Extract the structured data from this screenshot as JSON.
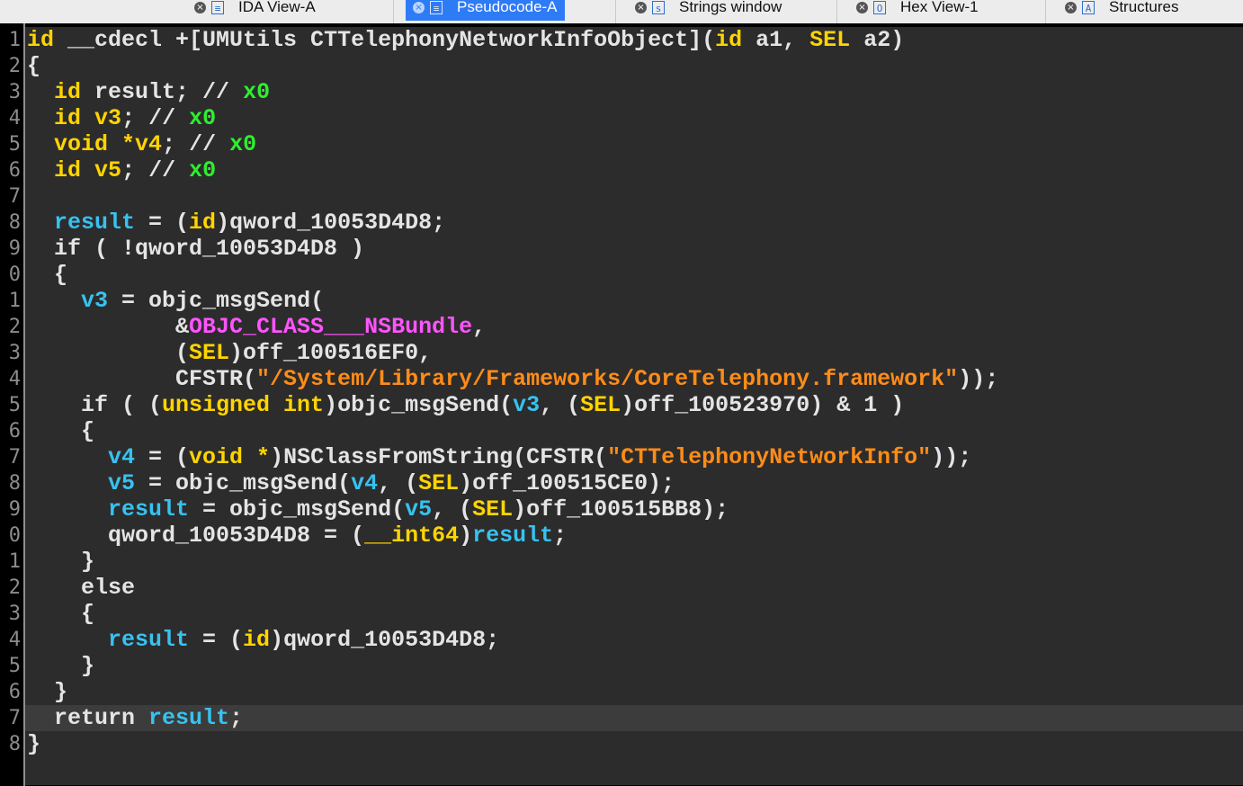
{
  "tabs": [
    {
      "label": "IDA View-A",
      "type_glyph": "≡",
      "active": false
    },
    {
      "label": "Pseudocode-A",
      "type_glyph": "≡",
      "active": true
    },
    {
      "label": "Strings window",
      "type_glyph": "s",
      "active": false
    },
    {
      "label": "Hex View-1",
      "type_glyph": "O",
      "active": false
    },
    {
      "label": "Structures",
      "type_glyph": "A",
      "active": false
    }
  ],
  "code": {
    "line_numbers": [
      "1",
      "2",
      "3",
      "4",
      "5",
      "6",
      "7",
      "8",
      "9",
      "0",
      "1",
      "2",
      "3",
      "4",
      "5",
      "6",
      "7",
      "8",
      "9",
      "0",
      "1",
      "2",
      "3",
      "4",
      "5",
      "6",
      "7",
      "8"
    ],
    "lines": [
      [
        {
          "c": "t-ty",
          "t": "id"
        },
        {
          "c": "t-f",
          "t": " __cdecl +[UMUtils CTTelephonyNetworkInfoObject]("
        },
        {
          "c": "t-ty",
          "t": "id"
        },
        {
          "c": "t-f",
          "t": " a1, "
        },
        {
          "c": "t-ty",
          "t": "SEL"
        },
        {
          "c": "t-f",
          "t": " a2)"
        }
      ],
      [
        {
          "c": "t-p",
          "t": "{"
        }
      ],
      [
        {
          "c": "t-f",
          "t": "  "
        },
        {
          "c": "t-ty",
          "t": "id"
        },
        {
          "c": "t-f",
          "t": " result; // "
        },
        {
          "c": "t-n",
          "t": "x0"
        }
      ],
      [
        {
          "c": "t-f",
          "t": "  "
        },
        {
          "c": "t-ty",
          "t": "id"
        },
        {
          "c": "t-f",
          "t": " "
        },
        {
          "c": "t-ty",
          "t": "v3"
        },
        {
          "c": "t-f",
          "t": "; // "
        },
        {
          "c": "t-n",
          "t": "x0"
        }
      ],
      [
        {
          "c": "t-f",
          "t": "  "
        },
        {
          "c": "t-ty",
          "t": "void"
        },
        {
          "c": "t-f",
          "t": " "
        },
        {
          "c": "t-ty",
          "t": "*v4"
        },
        {
          "c": "t-f",
          "t": "; // "
        },
        {
          "c": "t-n",
          "t": "x0"
        }
      ],
      [
        {
          "c": "t-f",
          "t": "  "
        },
        {
          "c": "t-ty",
          "t": "id"
        },
        {
          "c": "t-f",
          "t": " "
        },
        {
          "c": "t-ty",
          "t": "v5"
        },
        {
          "c": "t-f",
          "t": "; // "
        },
        {
          "c": "t-n",
          "t": "x0"
        }
      ],
      [
        {
          "c": "t-f",
          "t": ""
        }
      ],
      [
        {
          "c": "t-f",
          "t": "  "
        },
        {
          "c": "t-v",
          "t": "result"
        },
        {
          "c": "t-f",
          "t": " = ("
        },
        {
          "c": "t-ty",
          "t": "id"
        },
        {
          "c": "t-f",
          "t": ")qword_10053D4D8;"
        }
      ],
      [
        {
          "c": "t-f",
          "t": "  if ( !qword_10053D4D8 )"
        }
      ],
      [
        {
          "c": "t-f",
          "t": "  {"
        }
      ],
      [
        {
          "c": "t-f",
          "t": "    "
        },
        {
          "c": "t-v",
          "t": "v3"
        },
        {
          "c": "t-f",
          "t": " = objc_msgSend("
        }
      ],
      [
        {
          "c": "t-f",
          "t": "           &"
        },
        {
          "c": "t-m",
          "t": "OBJC_CLASS___NSBundle"
        },
        {
          "c": "t-f",
          "t": ","
        }
      ],
      [
        {
          "c": "t-f",
          "t": "           ("
        },
        {
          "c": "t-ty",
          "t": "SEL"
        },
        {
          "c": "t-f",
          "t": ")off_100516EF0,"
        }
      ],
      [
        {
          "c": "t-f",
          "t": "           CFSTR("
        },
        {
          "c": "t-s",
          "t": "\"/System/Library/Frameworks/CoreTelephony.framework\""
        },
        {
          "c": "t-f",
          "t": "));"
        }
      ],
      [
        {
          "c": "t-f",
          "t": "    if ( ("
        },
        {
          "c": "t-ty",
          "t": "unsigned int"
        },
        {
          "c": "t-f",
          "t": ")objc_msgSend("
        },
        {
          "c": "t-v",
          "t": "v3"
        },
        {
          "c": "t-f",
          "t": ", ("
        },
        {
          "c": "t-ty",
          "t": "SEL"
        },
        {
          "c": "t-f",
          "t": ")off_100523970) & 1 )"
        }
      ],
      [
        {
          "c": "t-f",
          "t": "    {"
        }
      ],
      [
        {
          "c": "t-f",
          "t": "      "
        },
        {
          "c": "t-v",
          "t": "v4"
        },
        {
          "c": "t-f",
          "t": " = ("
        },
        {
          "c": "t-ty",
          "t": "void *"
        },
        {
          "c": "t-f",
          "t": ")NSClassFromString(CFSTR("
        },
        {
          "c": "t-s",
          "t": "\"CTTelephonyNetworkInfo\""
        },
        {
          "c": "t-f",
          "t": "));"
        }
      ],
      [
        {
          "c": "t-f",
          "t": "      "
        },
        {
          "c": "t-v",
          "t": "v5"
        },
        {
          "c": "t-f",
          "t": " = objc_msgSend("
        },
        {
          "c": "t-v",
          "t": "v4"
        },
        {
          "c": "t-f",
          "t": ", ("
        },
        {
          "c": "t-ty",
          "t": "SEL"
        },
        {
          "c": "t-f",
          "t": ")off_100515CE0);"
        }
      ],
      [
        {
          "c": "t-f",
          "t": "      "
        },
        {
          "c": "t-v",
          "t": "result"
        },
        {
          "c": "t-f",
          "t": " = objc_msgSend("
        },
        {
          "c": "t-v",
          "t": "v5"
        },
        {
          "c": "t-f",
          "t": ", ("
        },
        {
          "c": "t-ty",
          "t": "SEL"
        },
        {
          "c": "t-f",
          "t": ")off_100515BB8);"
        }
      ],
      [
        {
          "c": "t-f",
          "t": "      qword_10053D4D8 = ("
        },
        {
          "c": "t-ty",
          "t": "__int64"
        },
        {
          "c": "t-f",
          "t": ")"
        },
        {
          "c": "t-v",
          "t": "result"
        },
        {
          "c": "t-f",
          "t": ";"
        }
      ],
      [
        {
          "c": "t-f",
          "t": "    }"
        }
      ],
      [
        {
          "c": "t-f",
          "t": "    else"
        }
      ],
      [
        {
          "c": "t-f",
          "t": "    {"
        }
      ],
      [
        {
          "c": "t-f",
          "t": "      "
        },
        {
          "c": "t-v",
          "t": "result"
        },
        {
          "c": "t-f",
          "t": " = ("
        },
        {
          "c": "t-ty",
          "t": "id"
        },
        {
          "c": "t-f",
          "t": ")qword_10053D4D8;"
        }
      ],
      [
        {
          "c": "t-f",
          "t": "    }"
        }
      ],
      [
        {
          "c": "t-f",
          "t": "  }"
        }
      ],
      [
        {
          "c": "t-f",
          "t": "  return "
        },
        {
          "c": "t-v",
          "t": "result"
        },
        {
          "c": "t-f",
          "t": ";"
        }
      ],
      [
        {
          "c": "t-f",
          "t": "}"
        }
      ]
    ],
    "highlighted_line": 27
  }
}
